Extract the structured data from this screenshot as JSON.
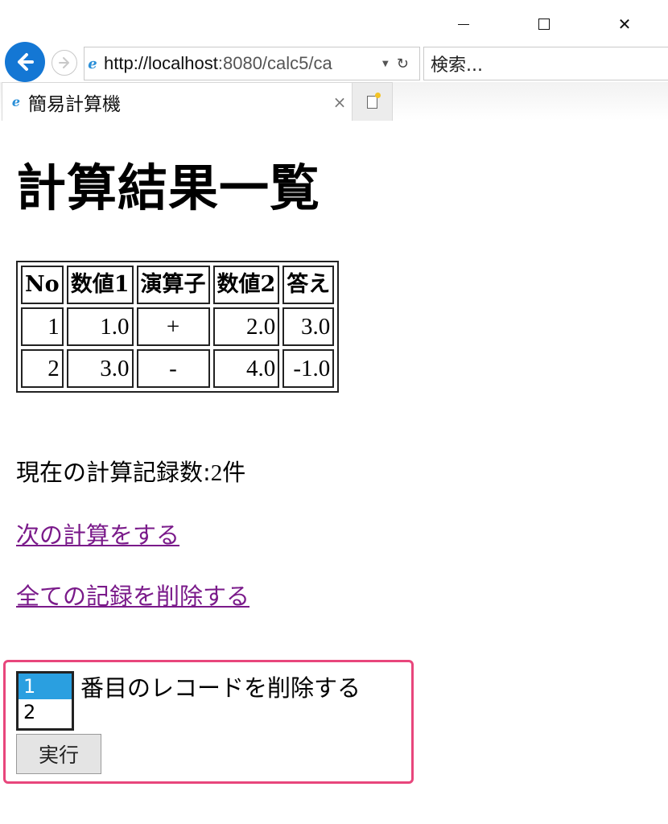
{
  "window": {
    "minimize_label": "–",
    "maximize_label": "□",
    "close_label": "✕"
  },
  "navigation": {
    "address_url_host": "http://localhost",
    "address_url_rest": ":8080/calc5/ca",
    "search_placeholder": "検索...",
    "back_icon": "back-arrow-icon",
    "forward_icon": "forward-arrow-icon",
    "refresh_icon": "refresh-icon"
  },
  "tabs": [
    {
      "label": "簡易計算機",
      "close_label": "×",
      "active": true
    }
  ],
  "page": {
    "heading": "計算結果一覧",
    "table": {
      "headers": [
        "No",
        "数値1",
        "演算子",
        "数値2",
        "答え"
      ],
      "rows": [
        [
          "1",
          "1.0",
          "+",
          "2.0",
          "3.0"
        ],
        [
          "2",
          "3.0",
          "-",
          "4.0",
          "-1.0"
        ]
      ]
    },
    "record_count_label": "現在の計算記録数:",
    "record_count_value": "2件",
    "next_link": "次の計算をする",
    "delete_all_link": "全ての記録を削除する",
    "delete_form": {
      "options": [
        "1",
        "2"
      ],
      "selected": "1",
      "label": "番目のレコードを削除する",
      "submit_label": "実行"
    }
  },
  "colors": {
    "link": "#7a1a8a",
    "highlight_border": "#e8467c",
    "selection": "#2a9fe0",
    "back_button": "#1477d4"
  }
}
